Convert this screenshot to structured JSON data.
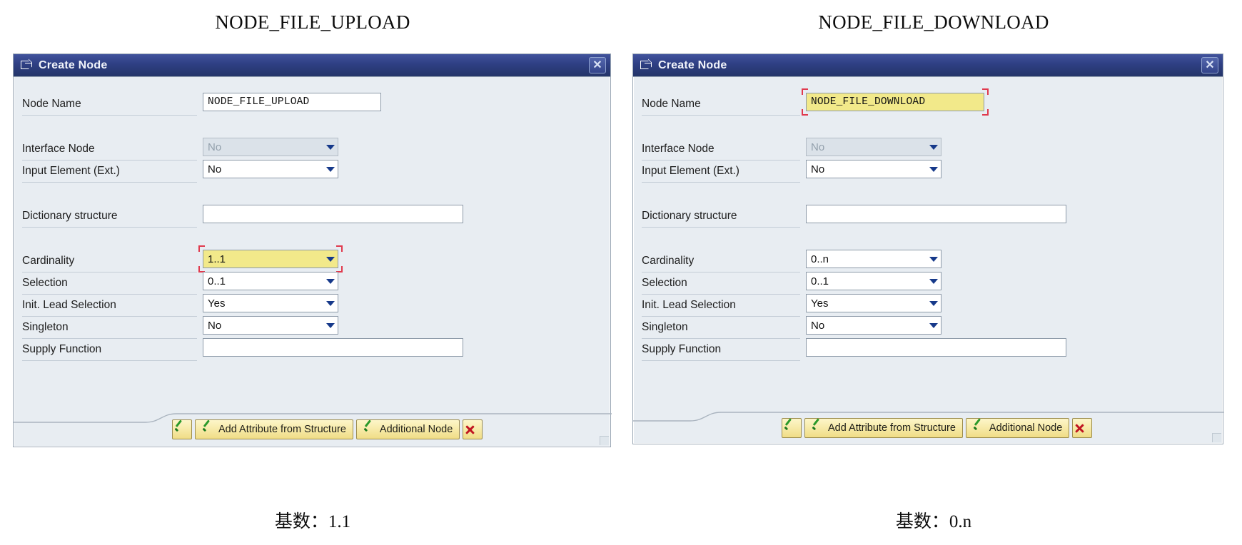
{
  "columns": [
    {
      "header": "NODE_FILE_UPLOAD",
      "caption": "基数：1.1",
      "dialog": {
        "title": "Create Node",
        "icon": "create-node-icon",
        "close_label": "✕",
        "fields": {
          "node_name": {
            "label": "Node Name",
            "value": "NODE_FILE_UPLOAD",
            "highlighted": false
          },
          "interface_node": {
            "label": "Interface Node",
            "value": "No",
            "disabled": true
          },
          "input_element": {
            "label": "Input Element (Ext.)",
            "value": "No"
          },
          "dictionary_structure": {
            "label": "Dictionary structure",
            "value": ""
          },
          "cardinality": {
            "label": "Cardinality",
            "value": "1..1",
            "highlighted": true
          },
          "selection": {
            "label": "Selection",
            "value": "0..1"
          },
          "init_lead_selection": {
            "label": "Init. Lead Selection",
            "value": "Yes"
          },
          "singleton": {
            "label": "Singleton",
            "value": "No"
          },
          "supply_function": {
            "label": "Supply Function",
            "value": ""
          }
        },
        "buttons": {
          "confirm": "",
          "add_attribute": "Add Attribute from Structure",
          "additional_node": "Additional Node",
          "cancel": ""
        }
      }
    },
    {
      "header": "NODE_FILE_DOWNLOAD",
      "caption": "基数：0.n",
      "dialog": {
        "title": "Create Node",
        "icon": "create-node-icon",
        "close_label": "✕",
        "fields": {
          "node_name": {
            "label": "Node Name",
            "value": "NODE_FILE_DOWNLOAD",
            "highlighted": true
          },
          "interface_node": {
            "label": "Interface Node",
            "value": "No",
            "disabled": true
          },
          "input_element": {
            "label": "Input Element (Ext.)",
            "value": "No"
          },
          "dictionary_structure": {
            "label": "Dictionary structure",
            "value": ""
          },
          "cardinality": {
            "label": "Cardinality",
            "value": "0..n",
            "highlighted": false
          },
          "selection": {
            "label": "Selection",
            "value": "0..1"
          },
          "init_lead_selection": {
            "label": "Init. Lead Selection",
            "value": "Yes"
          },
          "singleton": {
            "label": "Singleton",
            "value": "No"
          },
          "supply_function": {
            "label": "Supply Function",
            "value": ""
          }
        },
        "buttons": {
          "confirm": "",
          "add_attribute": "Add Attribute from Structure",
          "additional_node": "Additional Node",
          "cancel": ""
        }
      }
    }
  ],
  "colors": {
    "titlebar": "#2e3f83",
    "dialog_bg": "#e8edf2",
    "highlight": "#f2e98a",
    "focus_bracket": "#e03a4e",
    "button": "#f0dd86",
    "check_green": "#2a9a2a",
    "x_red": "#c01521"
  }
}
